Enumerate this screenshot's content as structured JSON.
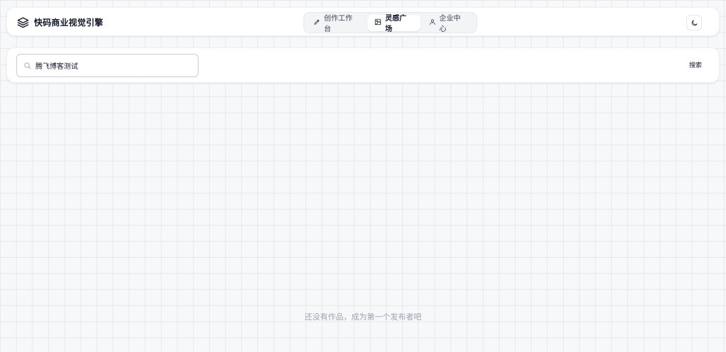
{
  "header": {
    "brand_icon": "layers-icon",
    "brand_title": "快码商业视觉引擎",
    "tabs": [
      {
        "label": "创作工作台",
        "icon": "pencil-icon",
        "active": false
      },
      {
        "label": "灵感广场",
        "icon": "image-icon",
        "active": true
      },
      {
        "label": "企业中心",
        "icon": "user-icon",
        "active": false
      }
    ],
    "theme_toggle_icon": "moon-icon"
  },
  "search": {
    "icon": "search-icon",
    "value": "腾飞博客测试",
    "button_label": "搜索"
  },
  "empty_state": {
    "message": "还没有作品，成为第一个发布者吧"
  },
  "colors": {
    "background": "#f7f8fa",
    "grid_line": "#e6e8ec",
    "card": "#ffffff",
    "muted_text": "#9ca3af"
  }
}
